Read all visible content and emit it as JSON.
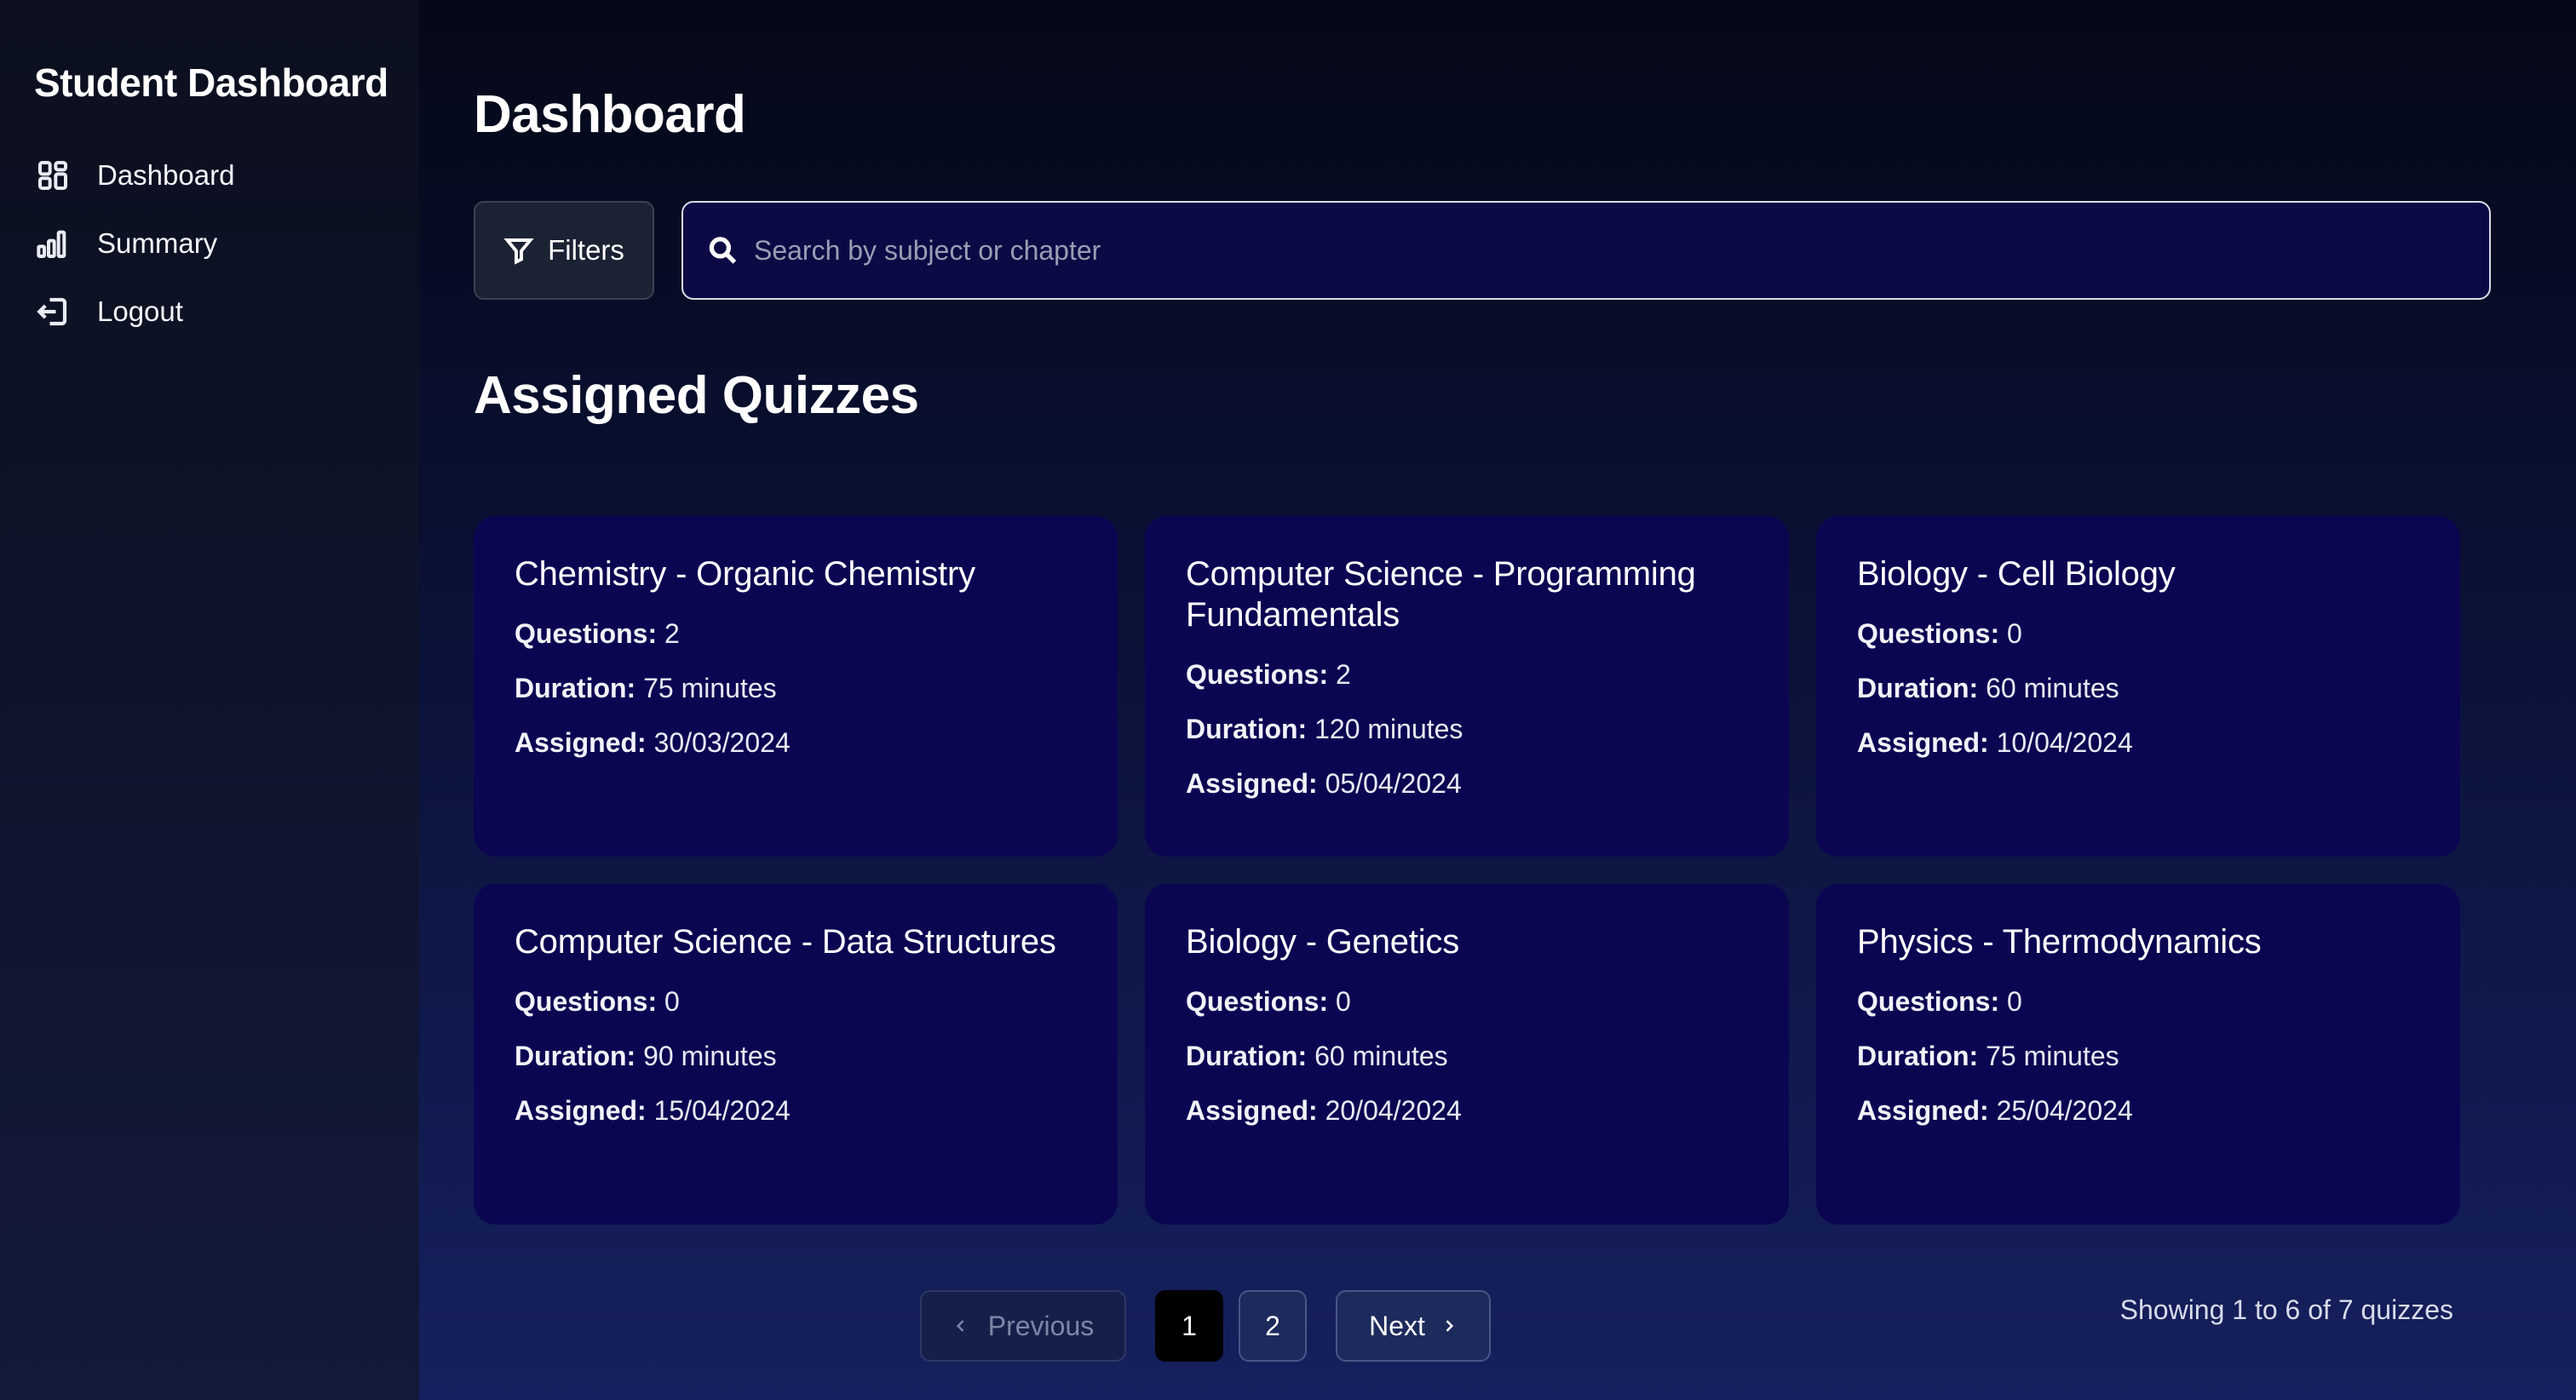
{
  "sidebar": {
    "title": "Student Dashboard",
    "items": [
      {
        "label": "Dashboard",
        "icon": "dashboard-grid-icon"
      },
      {
        "label": "Summary",
        "icon": "bar-chart-icon"
      },
      {
        "label": "Logout",
        "icon": "logout-icon"
      }
    ]
  },
  "header": {
    "title": "Dashboard"
  },
  "toolbar": {
    "filters_label": "Filters",
    "search_placeholder": "Search by subject or chapter"
  },
  "section": {
    "title": "Assigned Quizzes"
  },
  "labels": {
    "questions": "Questions:",
    "duration": "Duration:",
    "assigned": "Assigned:"
  },
  "quizzes": [
    {
      "title": "Chemistry - Organic Chemistry",
      "questions": "2",
      "duration": "75 minutes",
      "assigned": "30/03/2024"
    },
    {
      "title": "Computer Science - Programming Fundamentals",
      "questions": "2",
      "duration": "120 minutes",
      "assigned": "05/04/2024"
    },
    {
      "title": "Biology - Cell Biology",
      "questions": "0",
      "duration": "60 minutes",
      "assigned": "10/04/2024"
    },
    {
      "title": "Computer Science - Data Structures",
      "questions": "0",
      "duration": "90 minutes",
      "assigned": "15/04/2024"
    },
    {
      "title": "Biology - Genetics",
      "questions": "0",
      "duration": "60 minutes",
      "assigned": "20/04/2024"
    },
    {
      "title": "Physics - Thermodynamics",
      "questions": "0",
      "duration": "75 minutes",
      "assigned": "25/04/2024"
    }
  ],
  "pagination": {
    "previous_label": "Previous",
    "pages": [
      "1",
      "2"
    ],
    "current_page": "1",
    "next_label": "Next",
    "summary": "Showing 1 to 6 of 7 quizzes"
  },
  "colors": {
    "card_bg": "#0b0652",
    "search_bg": "#0c0a44",
    "active_page_bg": "#000000"
  }
}
